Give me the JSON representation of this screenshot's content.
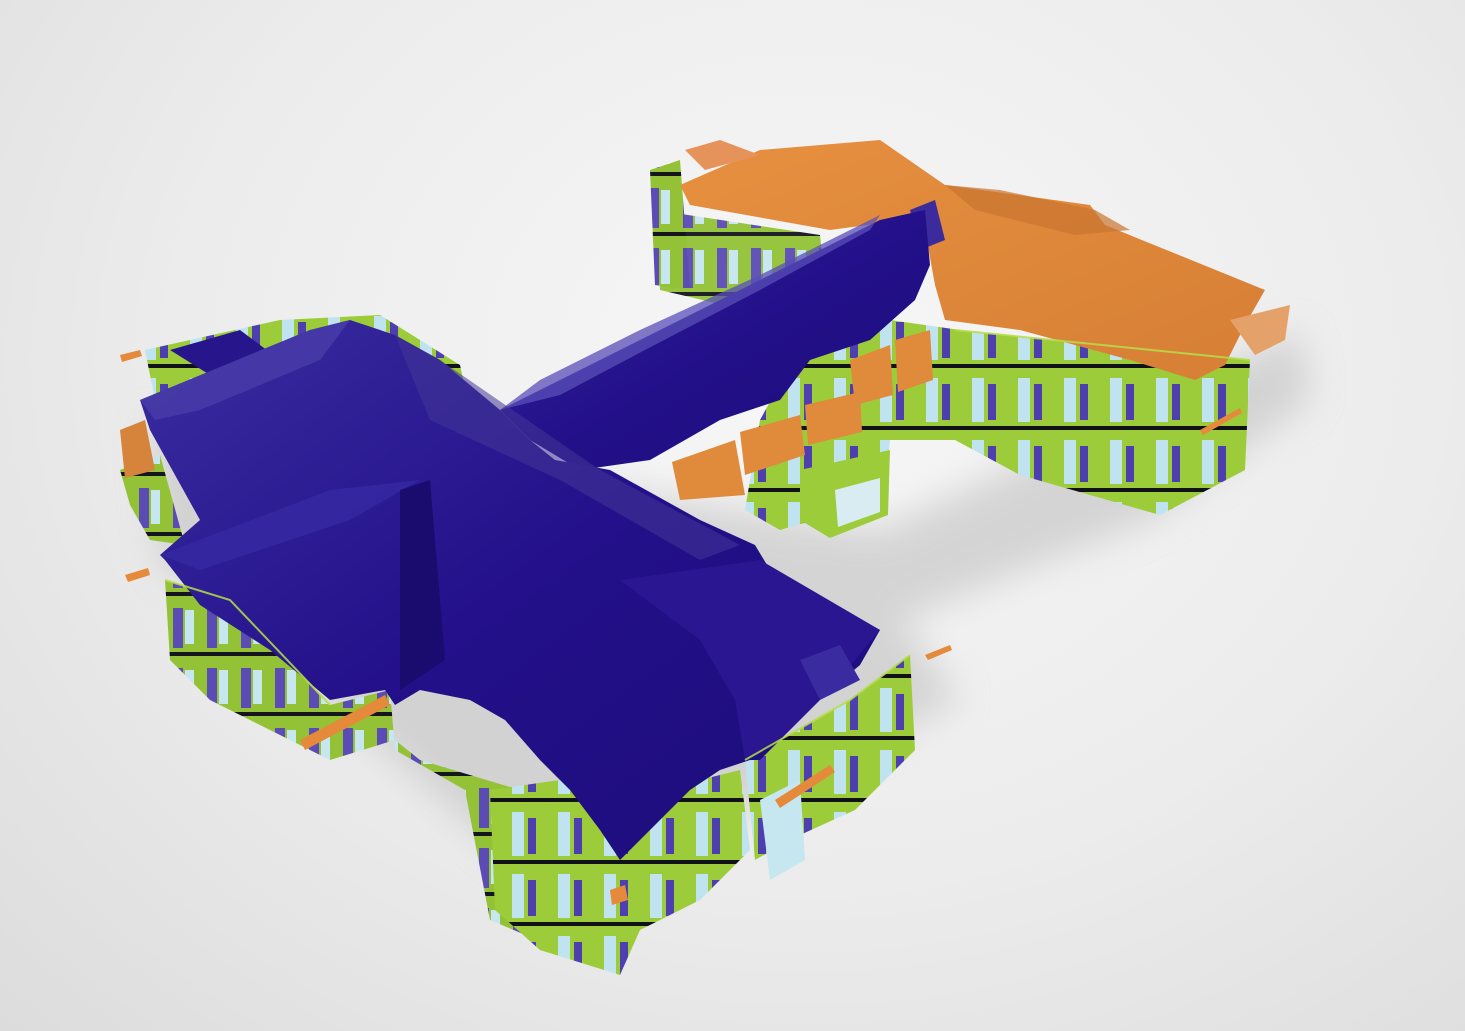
{
  "viewport": {
    "content": "3d-building-model",
    "background_color": "#ebebeb"
  },
  "materials": {
    "roof_primary": "#25128a",
    "roof_primary_light": "#4a3fa8",
    "roof_secondary": "#e0893d",
    "wall_exterior": "#93c236",
    "wall_interior": "#5a4bb5",
    "glazing": "#bfe3ef",
    "floor_slab": "#1a1a1a",
    "shadow": "#c8c8c8"
  }
}
